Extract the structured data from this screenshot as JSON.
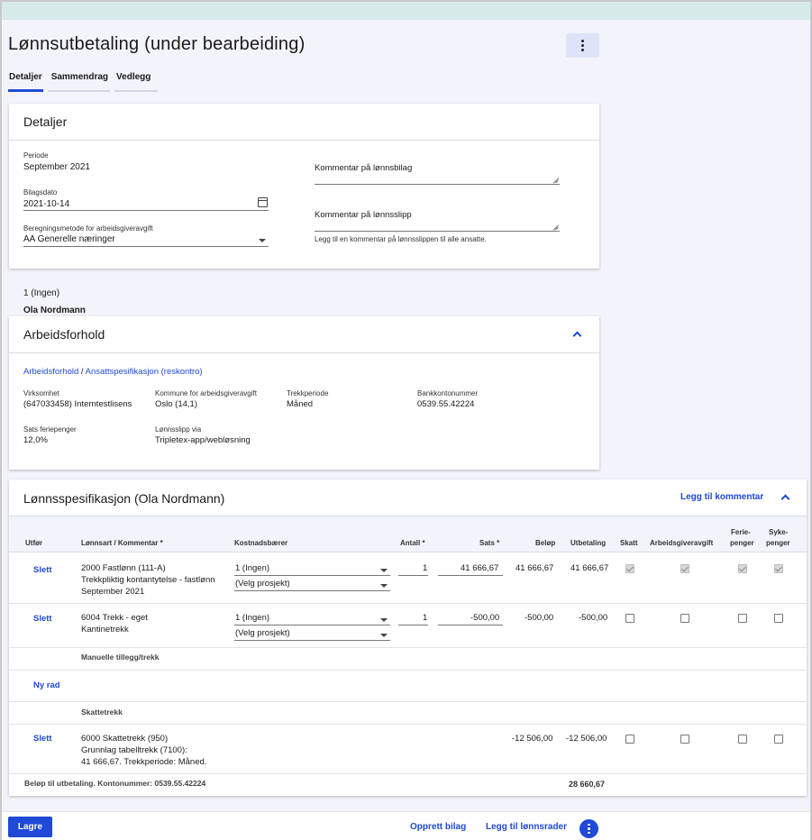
{
  "page": {
    "title": "Lønnsutbetaling (under bearbeiding)",
    "tabs": [
      "Detaljer",
      "Sammendrag",
      "Vedlegg"
    ]
  },
  "details": {
    "heading": "Detaljer",
    "periode_label": "Periode",
    "periode_value": "September 2021",
    "bilagsdato_label": "Bilagsdato",
    "bilagsdato_value": "2021-10-14",
    "beregning_label": "Beregningsmetode for arbeidsgiveravgift",
    "beregning_value": "AA Generelle næringer",
    "kommentar_bilag_label": "Kommentar på lønnsbilag",
    "kommentar_slipp_label": "Kommentar på lønnsslipp",
    "kommentar_slipp_hint": "Legg til en kommentar på lønnsslippen til alle ansatte."
  },
  "employee": {
    "number_line": "1 (Ingen)",
    "name": "Ola Nordmann"
  },
  "arbeidsforhold": {
    "heading": "Arbeidsforhold",
    "link1": "Arbeidsforhold",
    "separator": " / ",
    "link2": "Ansattspesifikasjon (reskontro)",
    "virksomhet_label": "Virksomhet",
    "virksomhet_value": "(647033458) Interntestlisens",
    "kommune_label": "Kommune for arbeidsgiveravgift",
    "kommune_value": "Oslo (14,1)",
    "trekkperiode_label": "Trekkperiode",
    "trekkperiode_value": "Måned",
    "bankkonto_label": "Bankkontonummer",
    "bankkonto_value": "0539.55.42224",
    "sats_label": "Sats feriepenger",
    "sats_value": "12,0%",
    "lonnsslipp_label": "Lønnsslipp via",
    "lonnsslipp_value": "Tripletex-app/webløsning"
  },
  "spec": {
    "heading": "Lønnsspesifikasjon (Ola Nordmann)",
    "add_comment": "Legg til kommentar",
    "headers": {
      "utfor": "Utfør",
      "lonnsart": "Lønnsart / Kommentar *",
      "kostnad": "Kostnadsbærer",
      "antall": "Antall *",
      "sats": "Sats *",
      "belop": "Beløp",
      "utbetaling": "Utbetaling",
      "skatt": "Skatt",
      "aga": "Arbeidsgiveravgift",
      "ferie1": "Ferie-",
      "ferie2": "penger",
      "syke1": "Syke-",
      "syke2": "penger"
    },
    "rows": [
      {
        "action": "Slett",
        "line1": "2000 Fastlønn (111-A)",
        "line2": "Trekkpliktig kontantytelse - fastlønn",
        "line3": "September 2021",
        "kostnad": "1 (Ingen)",
        "prosjekt": "(Velg prosjekt)",
        "antall": "1",
        "sats": "41 666,67",
        "belop": "41 666,67",
        "utbetaling": "41 666,67"
      },
      {
        "action": "Slett",
        "line1": "6004 Trekk - eget",
        "line2": "Kantinetrekk",
        "kostnad": "1 (Ingen)",
        "prosjekt": "(Velg prosjekt)",
        "antall": "1",
        "sats": "-500,00",
        "belop": "-500,00",
        "utbetaling": "-500,00"
      }
    ],
    "manual_section": "Manuelle tillegg/trekk",
    "new_row": "Ny rad",
    "tax_section": "Skattetrekk",
    "tax_row": {
      "action": "Slett",
      "line1": "6000 Skattetrekk (950)",
      "line2": "Grunnlag tabelltrekk (7100):",
      "line3": "41 666,67. Trekkperiode: Måned.",
      "belop": "-12 506,00",
      "utbetaling": "-12 506,00"
    },
    "total_label": "Beløp til utbetaling. Kontonummer:  0539.55.42224",
    "total_value": "28 660,67"
  },
  "footer": {
    "save": "Lagre",
    "create_voucher": "Opprett bilag",
    "add_to_payroll": "Legg til lønnsrader"
  },
  "colors": {
    "accent": "#1f49d6",
    "topbar": "#d7ebeb",
    "background": "#f3f4fb"
  }
}
